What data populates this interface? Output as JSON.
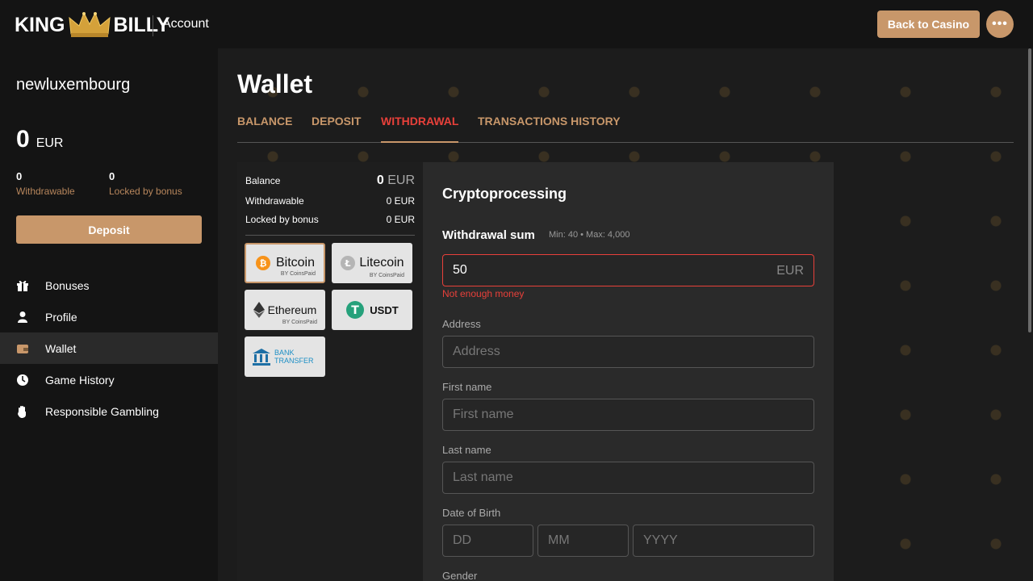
{
  "header": {
    "logo_left": "KING",
    "logo_right": "BILLY",
    "title": "Account",
    "back_button": "Back to Casino",
    "more_button": "•••"
  },
  "sidebar": {
    "username": "newluxembourg",
    "balance": "0",
    "currency": "EUR",
    "withdrawable_value": "0",
    "withdrawable_label": "Withdrawable",
    "locked_value": "0",
    "locked_label": "Locked by bonus",
    "deposit_button": "Deposit",
    "items": [
      {
        "label": "Bonuses",
        "icon": "gift-icon"
      },
      {
        "label": "Profile",
        "icon": "user-icon"
      },
      {
        "label": "Wallet",
        "icon": "wallet-icon",
        "active": true
      },
      {
        "label": "Game History",
        "icon": "clock-icon"
      },
      {
        "label": "Responsible Gambling",
        "icon": "hand-icon"
      }
    ]
  },
  "main": {
    "title": "Wallet",
    "tabs": [
      {
        "label": "BALANCE"
      },
      {
        "label": "DEPOSIT"
      },
      {
        "label": "WITHDRAWAL",
        "active": true
      },
      {
        "label": "TRANSACTIONS HISTORY"
      }
    ]
  },
  "summary": {
    "balance_label": "Balance",
    "balance_value": "0",
    "balance_currency": "EUR",
    "withdrawable_label": "Withdrawable",
    "withdrawable_value": "0 EUR",
    "locked_label": "Locked by bonus",
    "locked_value": "0 EUR"
  },
  "payment_methods": [
    {
      "name": "Bitcoin",
      "by": "BY CoinsPaid",
      "icon": "bitcoin-icon",
      "selected": true
    },
    {
      "name": "Litecoin",
      "by": "BY CoinsPaid",
      "icon": "litecoin-icon"
    },
    {
      "name": "Ethereum",
      "by": "BY CoinsPaid",
      "icon": "ethereum-icon"
    },
    {
      "name": "USDT",
      "by": "",
      "icon": "tether-icon"
    },
    {
      "name": "BANK TRANSFER",
      "by": "",
      "icon": "bank-icon"
    }
  ],
  "form": {
    "title": "Cryptoprocessing",
    "sum_label": "Withdrawal sum",
    "minmax": "Min: 40 • Max: 4,000",
    "sum_value": "50",
    "sum_currency": "EUR",
    "error": "Not enough money",
    "address_label": "Address",
    "address_placeholder": "Address",
    "first_name_label": "First name",
    "first_name_placeholder": "First name",
    "last_name_label": "Last name",
    "last_name_placeholder": "Last name",
    "dob_label": "Date of Birth",
    "dd_placeholder": "DD",
    "mm_placeholder": "MM",
    "yyyy_placeholder": "YYYY",
    "gender_label": "Gender"
  },
  "colors": {
    "accent": "#c8976a",
    "active_tab": "#e8403a",
    "error": "#e8403a"
  }
}
